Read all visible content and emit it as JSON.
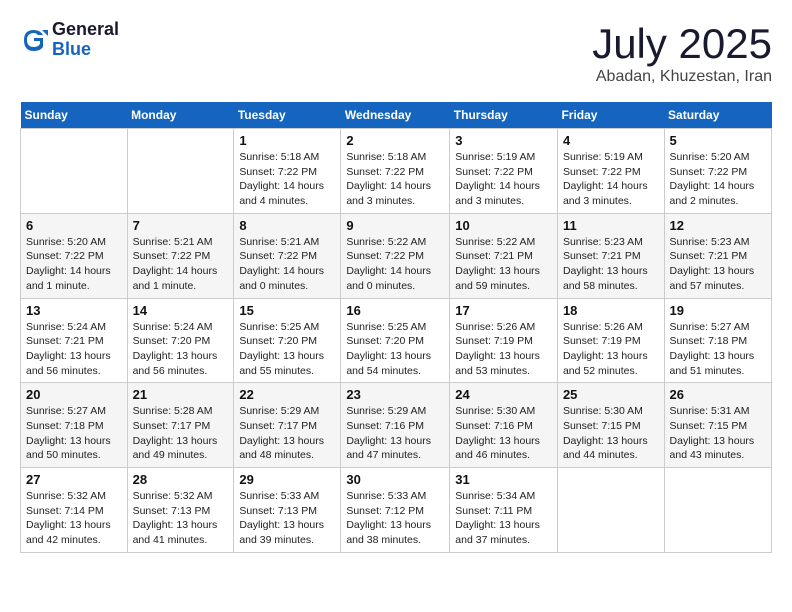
{
  "logo": {
    "general": "General",
    "blue": "Blue"
  },
  "title": "July 2025",
  "location": "Abadan, Khuzestan, Iran",
  "days_of_week": [
    "Sunday",
    "Monday",
    "Tuesday",
    "Wednesday",
    "Thursday",
    "Friday",
    "Saturday"
  ],
  "weeks": [
    [
      {
        "day": "",
        "info": ""
      },
      {
        "day": "",
        "info": ""
      },
      {
        "day": "1",
        "info": "Sunrise: 5:18 AM\nSunset: 7:22 PM\nDaylight: 14 hours and 4 minutes."
      },
      {
        "day": "2",
        "info": "Sunrise: 5:18 AM\nSunset: 7:22 PM\nDaylight: 14 hours and 3 minutes."
      },
      {
        "day": "3",
        "info": "Sunrise: 5:19 AM\nSunset: 7:22 PM\nDaylight: 14 hours and 3 minutes."
      },
      {
        "day": "4",
        "info": "Sunrise: 5:19 AM\nSunset: 7:22 PM\nDaylight: 14 hours and 3 minutes."
      },
      {
        "day": "5",
        "info": "Sunrise: 5:20 AM\nSunset: 7:22 PM\nDaylight: 14 hours and 2 minutes."
      }
    ],
    [
      {
        "day": "6",
        "info": "Sunrise: 5:20 AM\nSunset: 7:22 PM\nDaylight: 14 hours and 1 minute."
      },
      {
        "day": "7",
        "info": "Sunrise: 5:21 AM\nSunset: 7:22 PM\nDaylight: 14 hours and 1 minute."
      },
      {
        "day": "8",
        "info": "Sunrise: 5:21 AM\nSunset: 7:22 PM\nDaylight: 14 hours and 0 minutes."
      },
      {
        "day": "9",
        "info": "Sunrise: 5:22 AM\nSunset: 7:22 PM\nDaylight: 14 hours and 0 minutes."
      },
      {
        "day": "10",
        "info": "Sunrise: 5:22 AM\nSunset: 7:21 PM\nDaylight: 13 hours and 59 minutes."
      },
      {
        "day": "11",
        "info": "Sunrise: 5:23 AM\nSunset: 7:21 PM\nDaylight: 13 hours and 58 minutes."
      },
      {
        "day": "12",
        "info": "Sunrise: 5:23 AM\nSunset: 7:21 PM\nDaylight: 13 hours and 57 minutes."
      }
    ],
    [
      {
        "day": "13",
        "info": "Sunrise: 5:24 AM\nSunset: 7:21 PM\nDaylight: 13 hours and 56 minutes."
      },
      {
        "day": "14",
        "info": "Sunrise: 5:24 AM\nSunset: 7:20 PM\nDaylight: 13 hours and 56 minutes."
      },
      {
        "day": "15",
        "info": "Sunrise: 5:25 AM\nSunset: 7:20 PM\nDaylight: 13 hours and 55 minutes."
      },
      {
        "day": "16",
        "info": "Sunrise: 5:25 AM\nSunset: 7:20 PM\nDaylight: 13 hours and 54 minutes."
      },
      {
        "day": "17",
        "info": "Sunrise: 5:26 AM\nSunset: 7:19 PM\nDaylight: 13 hours and 53 minutes."
      },
      {
        "day": "18",
        "info": "Sunrise: 5:26 AM\nSunset: 7:19 PM\nDaylight: 13 hours and 52 minutes."
      },
      {
        "day": "19",
        "info": "Sunrise: 5:27 AM\nSunset: 7:18 PM\nDaylight: 13 hours and 51 minutes."
      }
    ],
    [
      {
        "day": "20",
        "info": "Sunrise: 5:27 AM\nSunset: 7:18 PM\nDaylight: 13 hours and 50 minutes."
      },
      {
        "day": "21",
        "info": "Sunrise: 5:28 AM\nSunset: 7:17 PM\nDaylight: 13 hours and 49 minutes."
      },
      {
        "day": "22",
        "info": "Sunrise: 5:29 AM\nSunset: 7:17 PM\nDaylight: 13 hours and 48 minutes."
      },
      {
        "day": "23",
        "info": "Sunrise: 5:29 AM\nSunset: 7:16 PM\nDaylight: 13 hours and 47 minutes."
      },
      {
        "day": "24",
        "info": "Sunrise: 5:30 AM\nSunset: 7:16 PM\nDaylight: 13 hours and 46 minutes."
      },
      {
        "day": "25",
        "info": "Sunrise: 5:30 AM\nSunset: 7:15 PM\nDaylight: 13 hours and 44 minutes."
      },
      {
        "day": "26",
        "info": "Sunrise: 5:31 AM\nSunset: 7:15 PM\nDaylight: 13 hours and 43 minutes."
      }
    ],
    [
      {
        "day": "27",
        "info": "Sunrise: 5:32 AM\nSunset: 7:14 PM\nDaylight: 13 hours and 42 minutes."
      },
      {
        "day": "28",
        "info": "Sunrise: 5:32 AM\nSunset: 7:13 PM\nDaylight: 13 hours and 41 minutes."
      },
      {
        "day": "29",
        "info": "Sunrise: 5:33 AM\nSunset: 7:13 PM\nDaylight: 13 hours and 39 minutes."
      },
      {
        "day": "30",
        "info": "Sunrise: 5:33 AM\nSunset: 7:12 PM\nDaylight: 13 hours and 38 minutes."
      },
      {
        "day": "31",
        "info": "Sunrise: 5:34 AM\nSunset: 7:11 PM\nDaylight: 13 hours and 37 minutes."
      },
      {
        "day": "",
        "info": ""
      },
      {
        "day": "",
        "info": ""
      }
    ]
  ]
}
